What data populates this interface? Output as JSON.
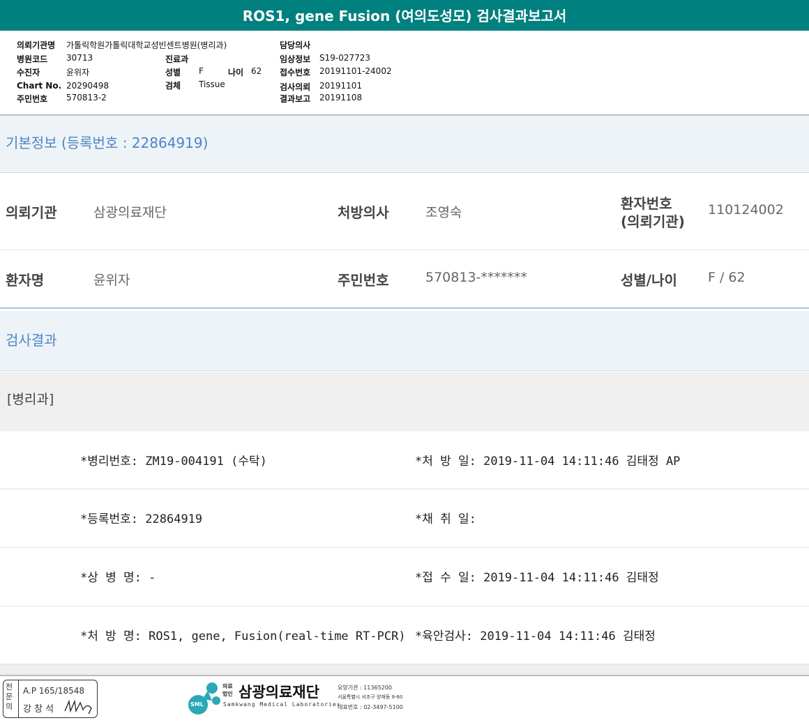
{
  "title": "ROS1, gene Fusion (여의도성모) 검사결과보고서",
  "header": {
    "inst_label": "의뢰기관명",
    "inst_value": "가톨릭학원가톨릭대학교성빈센트병원(병리과)",
    "code_label": "병원코드",
    "code_value": "30713",
    "recv_label": "수진자",
    "recv_value": "윤위자",
    "chart_label": "Chart No.",
    "chart_value": "20290498",
    "rrn_label": "주민번호",
    "rrn_value": "570813-2",
    "dept_label": "진료과",
    "sex_label": "성별",
    "sex_value": "F",
    "age_label": "나이",
    "age_value": "62",
    "spec_label": "검체",
    "spec_value": "Tissue",
    "doctor_label": "담당의사",
    "clin_label": "임상정보",
    "clin_value": "S19-027723",
    "acc_label": "접수번호",
    "acc_value": "20191101-24002",
    "req_label": "검사의뢰",
    "req_value": "20191101",
    "rep_label": "결과보고",
    "rep_value": "20191108"
  },
  "basic": {
    "heading": "기본정보 (등록번호 : 22864919)",
    "inst_label": "의뢰기관",
    "inst_value": "삼광의료재단",
    "doc_label": "처방의사",
    "doc_value": "조영숙",
    "pid_label1": "환자번호",
    "pid_label2": "(의뢰기관)",
    "pid_value": "110124002",
    "name_label": "환자명",
    "name_value": "윤위자",
    "rrn_label": "주민번호",
    "rrn_value": "570813-*******",
    "sexage_label": "성별/나이",
    "sexage_value": "F / 62"
  },
  "results": {
    "heading": "검사결과",
    "dept": "[병리과]",
    "rows": [
      {
        "left": "*병리번호: ZM19-004191 (수탁)",
        "right": "*처 방 일: 2019-11-04 14:11:46  김태정 AP"
      },
      {
        "left": "*등록번호: 22864919",
        "right": "*채 취 일:"
      },
      {
        "left": "*상 병 명: -",
        "right": "*접 수 일: 2019-11-04 14:11:46  김태정"
      },
      {
        "left": "*처 방 명: ROS1, gene, Fusion(real-time RT-PCR)",
        "right": "*육안검사: 2019-11-04 14:11:46  김태정"
      }
    ]
  },
  "footer": {
    "stamp_side": "전문의",
    "stamp_no": "A.P 165/18548",
    "stamp_name": "강 창 석",
    "logo_badge": "SML",
    "logo_prefix1": "의료",
    "logo_prefix2": "법인",
    "logo_name": "삼광의료재단",
    "logo_en": "Samkwang Medical Laboratories",
    "info1": "요양기관 : 11365200",
    "info2": "서울특별시 서초구 양재동 9-60",
    "info3": "대표번호 : 02-3497-5100"
  }
}
